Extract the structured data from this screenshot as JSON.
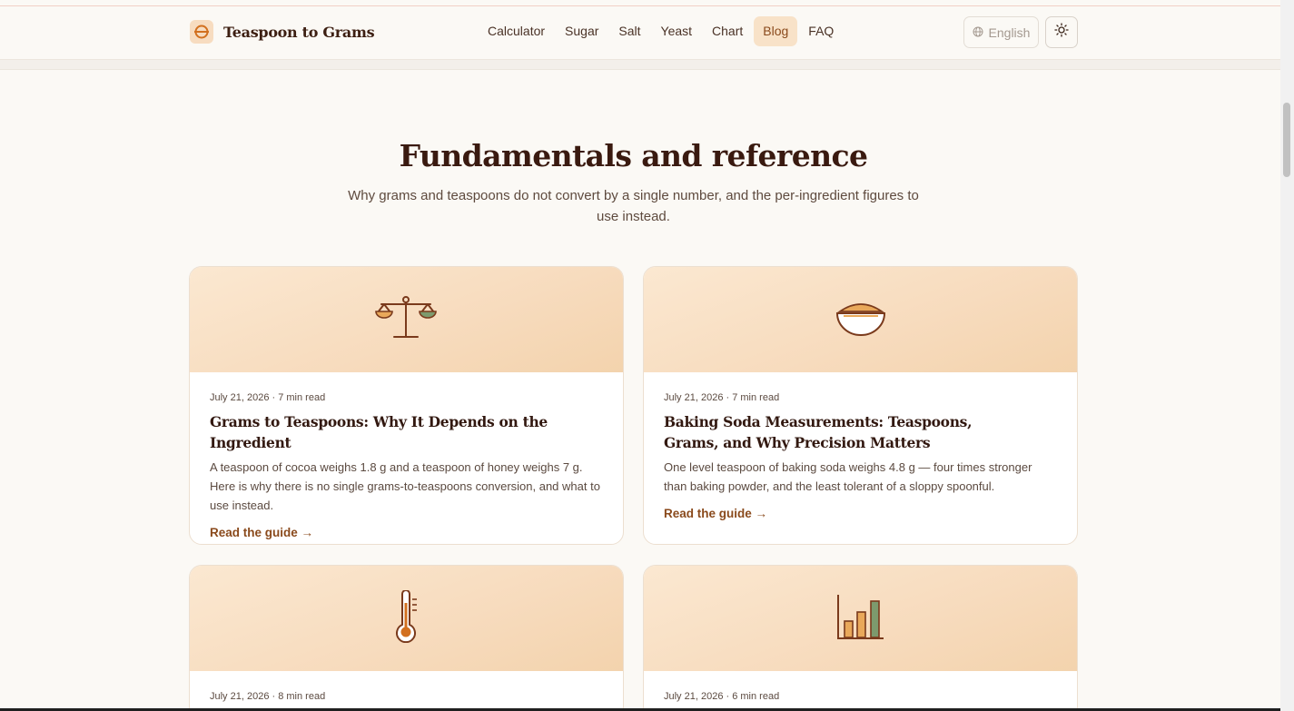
{
  "header": {
    "brand": "Teaspoon to Grams",
    "nav": [
      "Calculator",
      "Sugar",
      "Salt",
      "Yeast",
      "Chart",
      "Blog",
      "FAQ"
    ],
    "active_nav": "Blog",
    "language": "English"
  },
  "section": {
    "title": "Fundamentals and reference",
    "subtitle": "Why grams and teaspoons do not convert by a single number, and the per-ingredient figures to use instead."
  },
  "cards": [
    {
      "icon": "balance-scale-icon",
      "meta": "July 21, 2026 · 7 min read",
      "title": "Grams to Teaspoons: Why It Depends on the Ingredient",
      "excerpt": "A teaspoon of cocoa weighs 1.8 g and a teaspoon of honey weighs 7 g. Here is why there is no single grams-to-teaspoons conversion, and what to use instead.",
      "link": "Read the guide →"
    },
    {
      "icon": "bowl-icon",
      "meta": "July 21, 2026 · 7 min read",
      "title": "Baking Soda Measurements: Teaspoons, Grams, and Why Precision Matters",
      "excerpt": "One level teaspoon of baking soda weighs 4.8 g — four times stronger than baking powder, and the least tolerant of a sloppy spoonful.",
      "link": "Read the guide →"
    },
    {
      "icon": "thermometer-icon",
      "meta": "July 21, 2026 · 8 min read"
    },
    {
      "icon": "bar-chart-icon",
      "meta": "July 21, 2026 · 6 min read"
    }
  ],
  "colors": {
    "accent": "#8a4a1c",
    "active_nav_bg": "#f8e2c8",
    "card_hero": "#f7dbbd",
    "heading": "#3a1a10"
  }
}
